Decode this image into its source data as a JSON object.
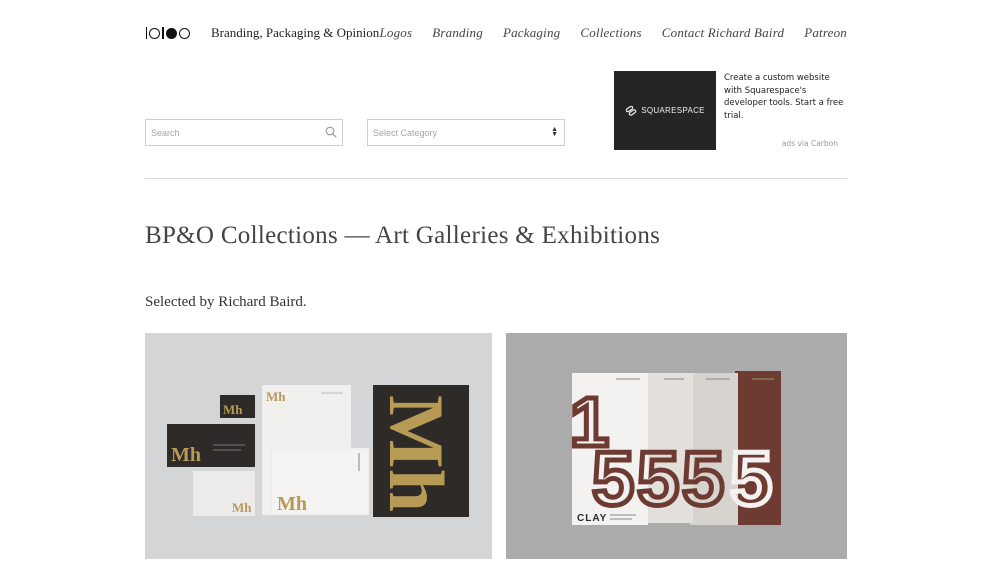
{
  "header": {
    "tagline": "Branding, Packaging & Opinion",
    "nav": [
      {
        "label": "Logos"
      },
      {
        "label": "Branding"
      },
      {
        "label": "Packaging"
      },
      {
        "label": "Collections"
      },
      {
        "label": "Contact Richard Baird"
      },
      {
        "label": "Patreon"
      }
    ]
  },
  "search": {
    "placeholder": "Search"
  },
  "category_select": {
    "selected": "Select Category"
  },
  "ad": {
    "brand": "SQUARESPACE",
    "text": "Create a custom website with Squarespace's developer tools. Start a free trial.",
    "via": "ads via Carbon"
  },
  "main": {
    "title": "BP&O Collections — Art Galleries & Exhibitions",
    "subtitle": "Selected by Richard Baird."
  },
  "cards": [
    {
      "mark": "Mh"
    },
    {
      "brand": "CLAY",
      "numbers": [
        "1",
        "5",
        "5",
        "5",
        "5"
      ]
    }
  ],
  "colors": {
    "card1_bg": "#d4d5d6",
    "card2_bg": "#ababab",
    "gold": "#b89a57",
    "dark_card": "#2e2a28",
    "maroon": "#6e3b33"
  }
}
